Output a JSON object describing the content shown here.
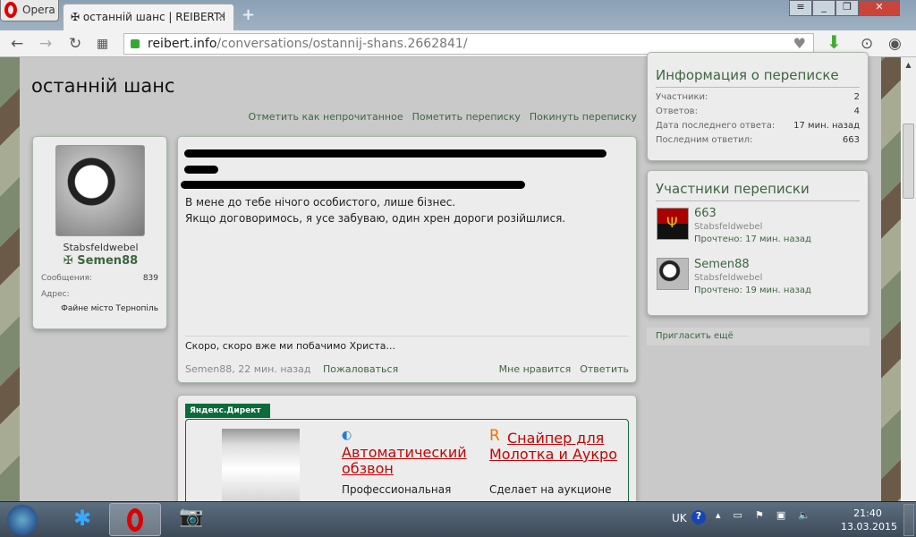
{
  "browser": {
    "opera_label": "Opera",
    "tab_title": "останній шанс | REIBERT.i",
    "url_host": "reibert.info",
    "url_path": "/conversations/ostannij-shans.2662841/"
  },
  "page": {
    "title": "останній шанс",
    "actions": [
      "Отметить как непрочитанное",
      "Пометить переписку",
      "Покинуть переписку"
    ]
  },
  "author": {
    "rank": "Stabsfeldwebel",
    "name": "Semen88",
    "messages_label": "Сообщения:",
    "messages": "839",
    "address_label": "Адрес:",
    "address": "Файне місто Тернопіль"
  },
  "message": {
    "lines": [
      "В мене до тебе нічого особистого, лише бізнес.",
      "Якщо договоримось, я усе забуваю, один хрен дороги розійшлися."
    ],
    "signature": "Скоро, скоро вже ми побачимо Христа...",
    "meta": "Semen88, 22 мин. назад",
    "report": "Пожаловаться",
    "like": "Мне нравится",
    "reply": "Ответить"
  },
  "ad": {
    "label": "Яндекс.Директ",
    "ad1_title": "Автоматический обзвон",
    "ad1_text": "Профессиональная",
    "ad2_title": "Снайпер для Молотка и Аукро",
    "ad2_text": "Сделает на аукционе"
  },
  "info": {
    "title": "Информация о переписке",
    "rows": [
      {
        "k": "Участники:",
        "v": "2"
      },
      {
        "k": "Ответов:",
        "v": "4"
      },
      {
        "k": "Дата последнего ответа:",
        "v": "17 мин. назад"
      },
      {
        "k": "Последним ответил:",
        "v": "663"
      }
    ]
  },
  "participants": {
    "title": "Участники переписки",
    "items": [
      {
        "name": "663",
        "rank": "Stabsfeldwebel",
        "read": "Прочтено: 17 мин. назад"
      },
      {
        "name": "Semen88",
        "rank": "Stabsfeldwebel",
        "read": "Прочтено: 19 мин. назад"
      }
    ],
    "invite": "Пригласить ещё"
  },
  "tray": {
    "lang": "UK",
    "time": "21:40",
    "date": "13.03.2015"
  }
}
